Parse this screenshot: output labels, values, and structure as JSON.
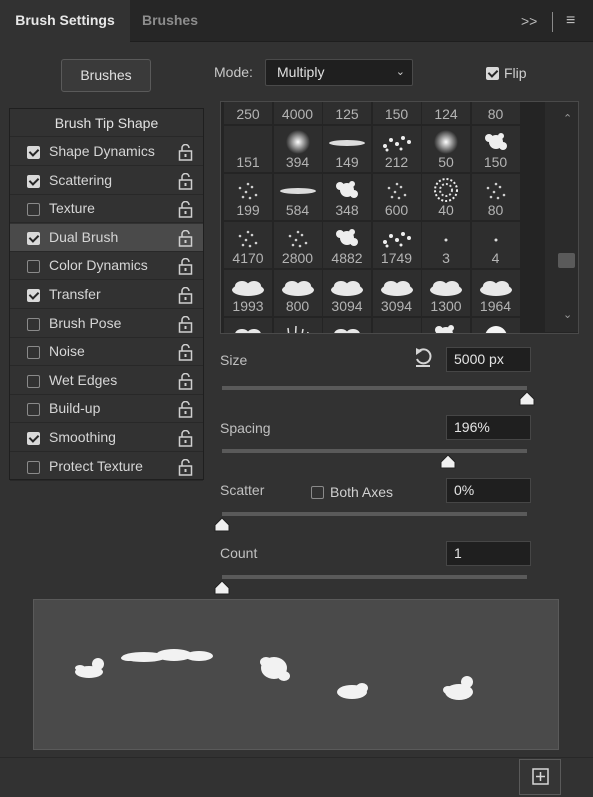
{
  "tabs": {
    "active": "Brush Settings",
    "inactive": "Brushes"
  },
  "tab_controls": {
    "collapse": ">>",
    "menu": "≡"
  },
  "brushes_button": "Brushes",
  "mode": {
    "label": "Mode:",
    "value": "Multiply"
  },
  "flip": {
    "label": "Flip",
    "checked": true
  },
  "tip_shape_title": "Brush Tip Shape",
  "options": [
    {
      "label": "Shape Dynamics",
      "checked": true
    },
    {
      "label": "Scattering",
      "checked": true
    },
    {
      "label": "Texture",
      "checked": false
    },
    {
      "label": "Dual Brush",
      "checked": true,
      "selected": true
    },
    {
      "label": "Color Dynamics",
      "checked": false
    },
    {
      "label": "Transfer",
      "checked": true
    },
    {
      "label": "Brush Pose",
      "checked": false
    },
    {
      "label": "Noise",
      "checked": false
    },
    {
      "label": "Wet Edges",
      "checked": false
    },
    {
      "label": "Build-up",
      "checked": false
    },
    {
      "label": "Smoothing",
      "checked": true
    },
    {
      "label": "Protect Texture",
      "checked": false
    }
  ],
  "brush_rows": [
    [
      "250",
      "4000",
      "125",
      "150",
      "124",
      "80"
    ],
    [
      "151",
      "394",
      "149",
      "212",
      "50",
      "150"
    ],
    [
      "199",
      "584",
      "348",
      "600",
      "40",
      "80"
    ],
    [
      "4170",
      "2800",
      "4882",
      "1749",
      "3",
      "4"
    ],
    [
      "1993",
      "800",
      "3094",
      "3094",
      "1300",
      "1964"
    ],
    [
      "",
      "",
      "",
      "",
      "",
      ""
    ]
  ],
  "size": {
    "label": "Size",
    "value": "5000 px",
    "level": 1.0
  },
  "spacing": {
    "label": "Spacing",
    "value": "196%",
    "level": 0.74
  },
  "scatter": {
    "label": "Scatter",
    "both_axes_label": "Both Axes",
    "both_axes_checked": false,
    "value": "0%",
    "level": 0.0
  },
  "count": {
    "label": "Count",
    "value": "1",
    "level": 0.0
  },
  "icons": {
    "collapse": "double-chevron-right-icon",
    "menu": "hamburger-menu-icon",
    "lock": "unlocked-padlock-icon",
    "reset": "reset-arrow-icon",
    "new": "new-preset-icon"
  }
}
